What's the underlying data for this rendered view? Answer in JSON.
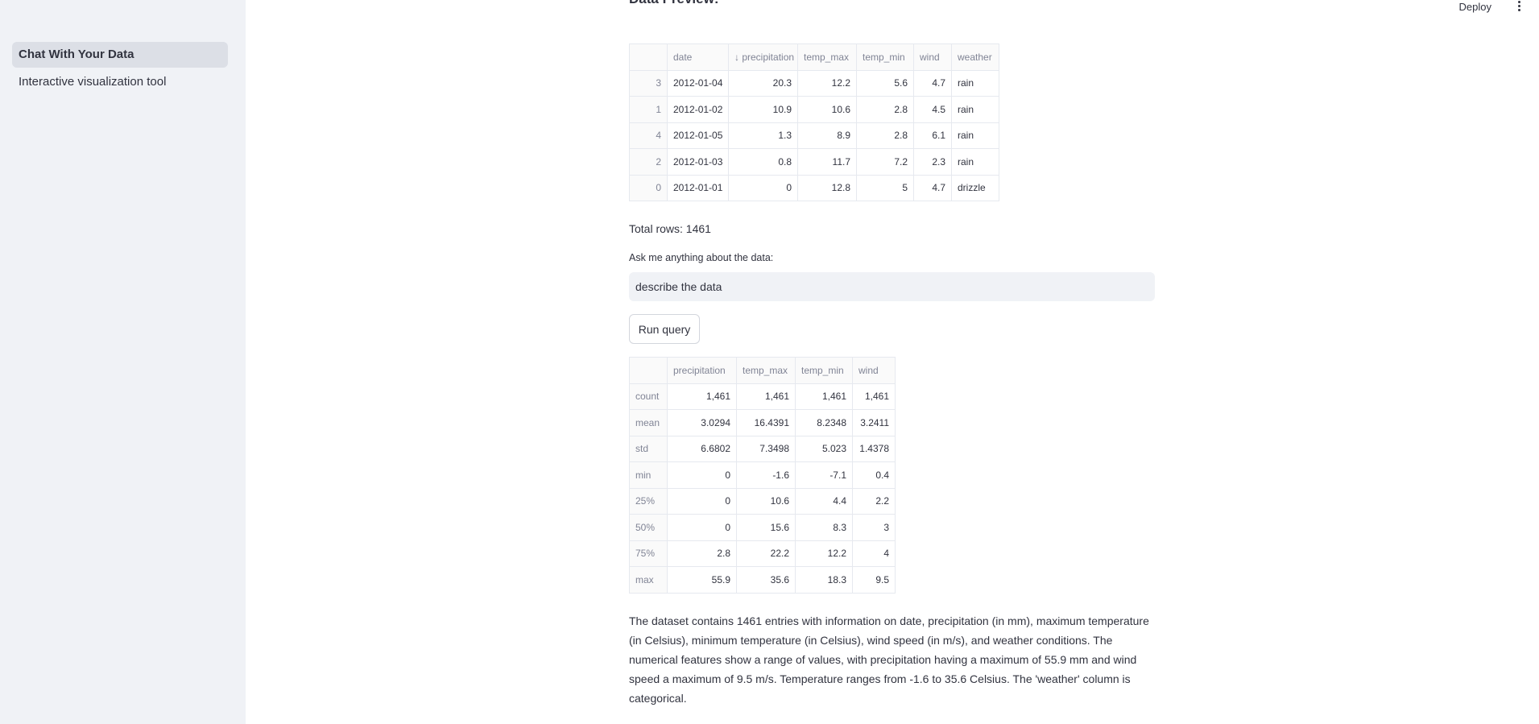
{
  "sidebar": {
    "items": [
      {
        "label": "Chat With Your Data",
        "active": true
      },
      {
        "label": "Interactive visualization tool",
        "active": false
      }
    ]
  },
  "topbar": {
    "deploy_label": "Deploy",
    "menu_icon": "vertical-dots-icon"
  },
  "preview": {
    "heading": "Data Preview:",
    "columns": [
      "",
      "date",
      "↓ precipitation",
      "temp_max",
      "temp_min",
      "wind",
      "weather"
    ],
    "rows": [
      [
        "3",
        "2012-01-04",
        "20.3",
        "12.2",
        "5.6",
        "4.7",
        "rain"
      ],
      [
        "1",
        "2012-01-02",
        "10.9",
        "10.6",
        "2.8",
        "4.5",
        "rain"
      ],
      [
        "4",
        "2012-01-05",
        "1.3",
        "8.9",
        "2.8",
        "6.1",
        "rain"
      ],
      [
        "2",
        "2012-01-03",
        "0.8",
        "11.7",
        "7.2",
        "2.3",
        "rain"
      ],
      [
        "0",
        "2012-01-01",
        "0",
        "12.8",
        "5",
        "4.7",
        "drizzle"
      ]
    ]
  },
  "total_rows": "Total rows: 1461",
  "query": {
    "label": "Ask me anything about the data:",
    "value": "describe the data",
    "run_label": "Run query"
  },
  "describe": {
    "columns": [
      "",
      "precipitation",
      "temp_max",
      "temp_min",
      "wind"
    ],
    "rows": [
      [
        "count",
        "1,461",
        "1,461",
        "1,461",
        "1,461"
      ],
      [
        "mean",
        "3.0294",
        "16.4391",
        "8.2348",
        "3.2411"
      ],
      [
        "std",
        "6.6802",
        "7.3498",
        "5.023",
        "1.4378"
      ],
      [
        "min",
        "0",
        "-1.6",
        "-7.1",
        "0.4"
      ],
      [
        "25%",
        "0",
        "10.6",
        "4.4",
        "2.2"
      ],
      [
        "50%",
        "0",
        "15.6",
        "8.3",
        "3"
      ],
      [
        "75%",
        "2.8",
        "22.2",
        "12.2",
        "4"
      ],
      [
        "max",
        "55.9",
        "35.6",
        "18.3",
        "9.5"
      ]
    ]
  },
  "answer": "The dataset contains 1461 entries with information on date, precipitation (in mm), maximum temperature (in Celsius), minimum temperature (in Celsius), wind speed (in m/s), and weather conditions. The numerical features show a range of values, with precipitation having a maximum of 55.9 mm and wind speed a maximum of 9.5 m/s. Temperature ranges from -1.6 to 35.6 Celsius. The 'weather' column is categorical."
}
